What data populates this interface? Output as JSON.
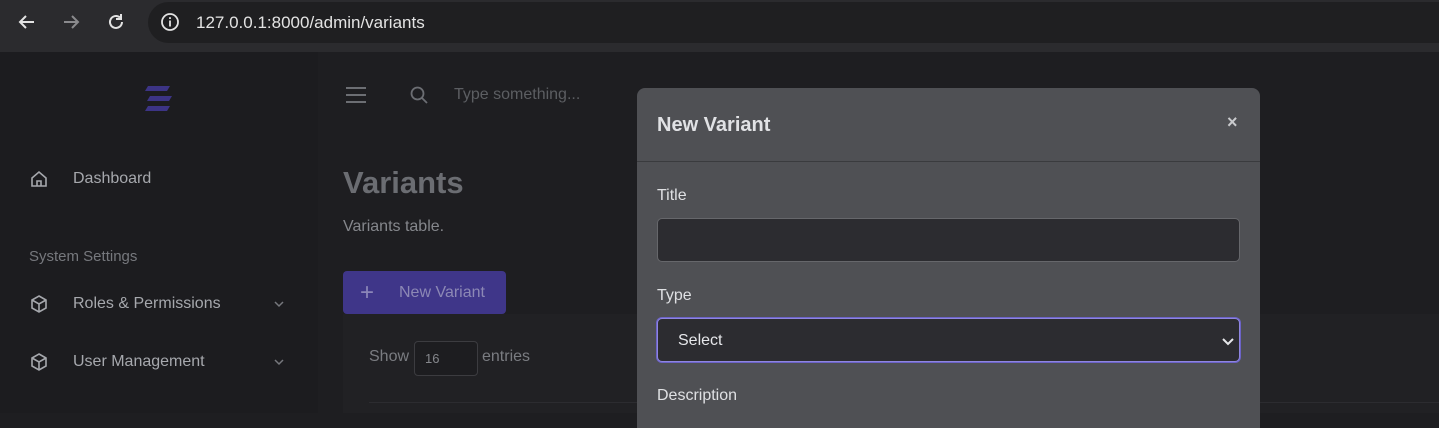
{
  "browser": {
    "url": "127.0.0.1:8000/admin/variants"
  },
  "sidebar": {
    "items": [
      {
        "label": "Dashboard",
        "icon": "home-icon"
      },
      {
        "label": "Roles & Permissions",
        "icon": "cube-icon"
      },
      {
        "label": "User Management",
        "icon": "cube-icon"
      }
    ],
    "section_label": "System Settings"
  },
  "topbar": {
    "search_placeholder": "Type something..."
  },
  "page": {
    "title": "Variants",
    "subtitle": "Variants table.",
    "new_button_label": "New Variant",
    "new_button_icon": "+",
    "show_label": "Show",
    "page_size": "16",
    "entries_label": "entries"
  },
  "modal": {
    "title": "New Variant",
    "close_symbol": "×",
    "fields": {
      "title_label": "Title",
      "title_value": "",
      "type_label": "Type",
      "type_value": "Select",
      "description_label": "Description"
    }
  },
  "colors": {
    "accent": "#3f3689",
    "modal_bg": "#4f5054",
    "select_focus": "#8f86e0"
  }
}
